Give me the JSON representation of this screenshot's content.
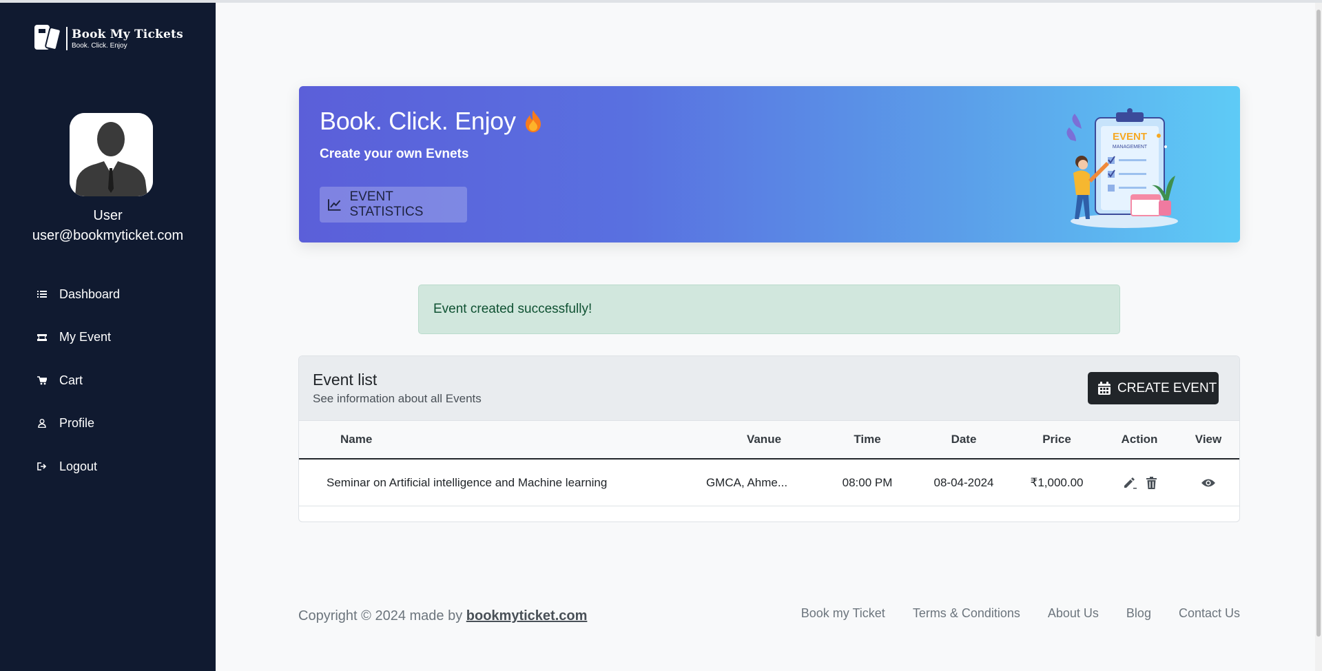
{
  "brand": {
    "title": "Book My Tickets",
    "tagline": "Book. Click. Enjoy"
  },
  "user": {
    "name": "User",
    "email": "user@bookmyticket.com"
  },
  "sidebar": {
    "items": [
      {
        "label": "Dashboard",
        "icon": "list-icon"
      },
      {
        "label": "My Event",
        "icon": "ticket-icon"
      },
      {
        "label": "Cart",
        "icon": "cart-icon"
      },
      {
        "label": "Profile",
        "icon": "user-icon"
      },
      {
        "label": "Logout",
        "icon": "logout-icon"
      }
    ]
  },
  "hero": {
    "title": "Book. Click. Enjoy",
    "subtitle": "Create your own Evnets",
    "stats_button": "EVENT STATISTICS",
    "art_title": "EVENT",
    "art_subtitle": "MANAGEMENT"
  },
  "alert": {
    "message": "Event created successfully!"
  },
  "event_list": {
    "title": "Event list",
    "description": "See information about all Events",
    "create_button": "CREATE EVENT",
    "columns": [
      "Name",
      "Vanue",
      "Time",
      "Date",
      "Price",
      "Action",
      "View"
    ],
    "rows": [
      {
        "name": "Seminar on Artificial intelligence and Machine learning",
        "venue": "GMCA, Ahme...",
        "time": "08:00 PM",
        "date": "08-04-2024",
        "price": "₹1,000.00"
      }
    ]
  },
  "footer": {
    "copyright_prefix": "Copyright © 2024 made by ",
    "copyright_link": "bookmyticket.com",
    "links": [
      "Book my Ticket",
      "Terms & Conditions",
      "About Us",
      "Blog",
      "Contact Us"
    ]
  },
  "colors": {
    "sidebar_bg": "#101a30",
    "hero_gradient_start": "#5b5fd9",
    "hero_gradient_end": "#5ecbf6",
    "alert_bg": "#d1e7dd",
    "alert_text": "#0f5132",
    "dark_button": "#212529"
  }
}
